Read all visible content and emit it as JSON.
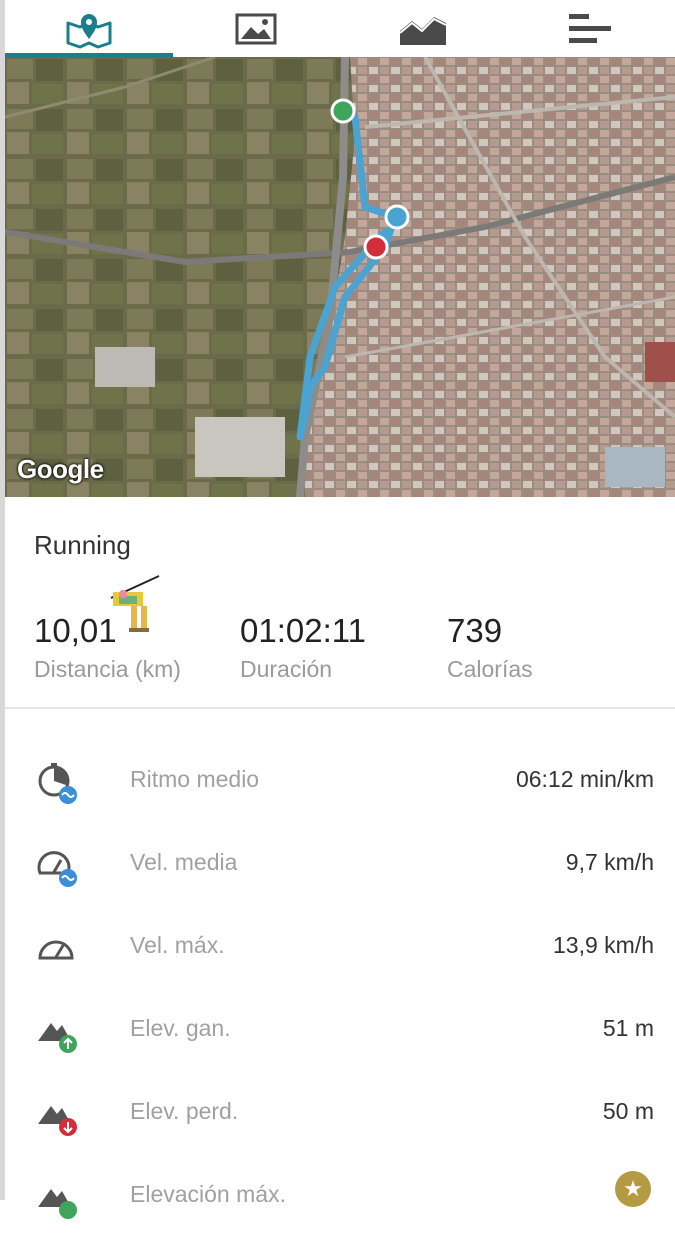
{
  "tabs": [
    {
      "name": "map-tab",
      "icon": "map-pin-icon",
      "active": true
    },
    {
      "name": "photos-tab",
      "icon": "image-icon",
      "active": false
    },
    {
      "name": "chart-tab",
      "icon": "trend-chart-icon",
      "active": false
    },
    {
      "name": "laps-tab",
      "icon": "bars-list-icon",
      "active": false
    }
  ],
  "map": {
    "attribution": "Google",
    "route_color": "#4ba3d1",
    "start_marker_color": "#3ea65a",
    "end_marker_color": "#d22d3a",
    "mid_marker_color": "#4ba3d1"
  },
  "activity": {
    "title": "Running"
  },
  "summary": {
    "distance_value": "10,01",
    "distance_label": "Distancia (km)",
    "duration_value": "01:02:11",
    "duration_label": "Duración",
    "calories_value": "739",
    "calories_label": "Calorías"
  },
  "stats": [
    {
      "icon": "avg-pace-icon",
      "label": "Ritmo medio",
      "value": "06:12 min/km"
    },
    {
      "icon": "avg-speed-icon",
      "label": "Vel. media",
      "value": "9,7 km/h"
    },
    {
      "icon": "max-speed-icon",
      "label": "Vel. máx.",
      "value": "13,9 km/h"
    },
    {
      "icon": "elevation-gain-icon",
      "label": "Elev. gan.",
      "value": "51 m"
    },
    {
      "icon": "elevation-loss-icon",
      "label": "Elev. perd.",
      "value": "50 m"
    },
    {
      "icon": "max-elevation-icon",
      "label": "Elevación máx.",
      "value": ""
    }
  ],
  "colors": {
    "accent": "#1a7f8a",
    "label_gray": "#9a9a9a"
  }
}
